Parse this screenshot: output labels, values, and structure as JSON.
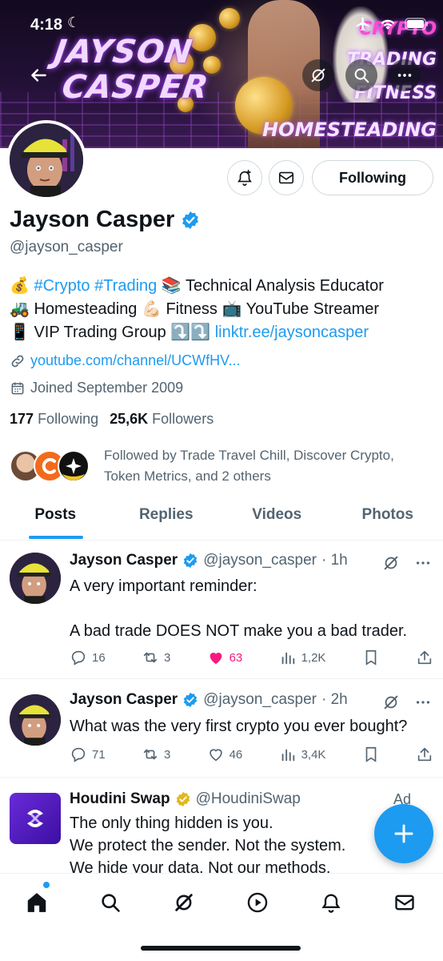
{
  "status_bar": {
    "time": "4:18",
    "moon": "☾"
  },
  "banner": {
    "title_line1": "JAYSON",
    "title_line2": "CASPER",
    "side_words": [
      "CRYPTO",
      "TRADING",
      "FITNESS",
      "HOMESTEADING"
    ]
  },
  "profile": {
    "display_name": "Jayson Casper",
    "handle": "@jayson_casper",
    "following_button": "Following",
    "bio": {
      "line1": {
        "emoji1": "💰",
        "tag1": "#Crypto",
        "tag2": "#Trading",
        "emoji2": "📚",
        "text": "Technical Analysis Educator"
      },
      "line2": {
        "emoji1": "🚜",
        "text1": "Homesteading",
        "emoji2": "💪🏻",
        "text2": "Fitness",
        "emoji3": "📺",
        "text3": "YouTube Streamer"
      },
      "line3": {
        "emoji1": "📱",
        "text": "VIP Trading Group",
        "emoji2": "⤵️⤵️",
        "link": "linktr.ee/jaysoncasper"
      }
    },
    "website": "youtube.com/channel/UCWfHV...",
    "joined": "Joined September 2009",
    "following_count": "177",
    "following_label": "Following",
    "followers_count": "25,6K",
    "followers_label": "Followers",
    "followed_by": "Followed by Trade Travel Chill, Discover Crypto, Token Metrics, and 2 others"
  },
  "tabs": [
    "Posts",
    "Replies",
    "Videos",
    "Photos"
  ],
  "posts": [
    {
      "name": "Jayson Casper",
      "handle": "@jayson_casper",
      "time": "· 1h",
      "text_line1": "A very important reminder:",
      "text_line2": "A bad trade DOES NOT make you a bad trader.",
      "replies": "16",
      "reposts": "3",
      "likes": "63",
      "views": "1,2K"
    },
    {
      "name": "Jayson Casper",
      "handle": "@jayson_casper",
      "time": "· 2h",
      "text_line1": "What was the very first crypto you ever bought?",
      "replies": "71",
      "reposts": "3",
      "likes": "46",
      "views": "3,4K"
    },
    {
      "name": "Houdini Swap",
      "handle": "@HoudiniSwap",
      "ad_label": "Ad",
      "text_line1": "The only thing hidden is you.",
      "text_line2": "We protect the sender. Not the system.",
      "text_line3": "We hide your data. Not our methods."
    }
  ],
  "colors": {
    "accent": "#1d9bf0",
    "like": "#f91880",
    "gold_badge": "#e2b719",
    "muted": "#536471"
  },
  "icons": [
    "back-arrow-icon",
    "grok-icon",
    "search-icon",
    "more-icon",
    "notification-add-icon",
    "mail-icon",
    "link-icon",
    "calendar-icon",
    "reply-icon",
    "repost-icon",
    "heart-icon",
    "views-icon",
    "bookmark-icon",
    "share-icon",
    "plus-icon",
    "home-icon",
    "play-icon",
    "bell-icon"
  ]
}
